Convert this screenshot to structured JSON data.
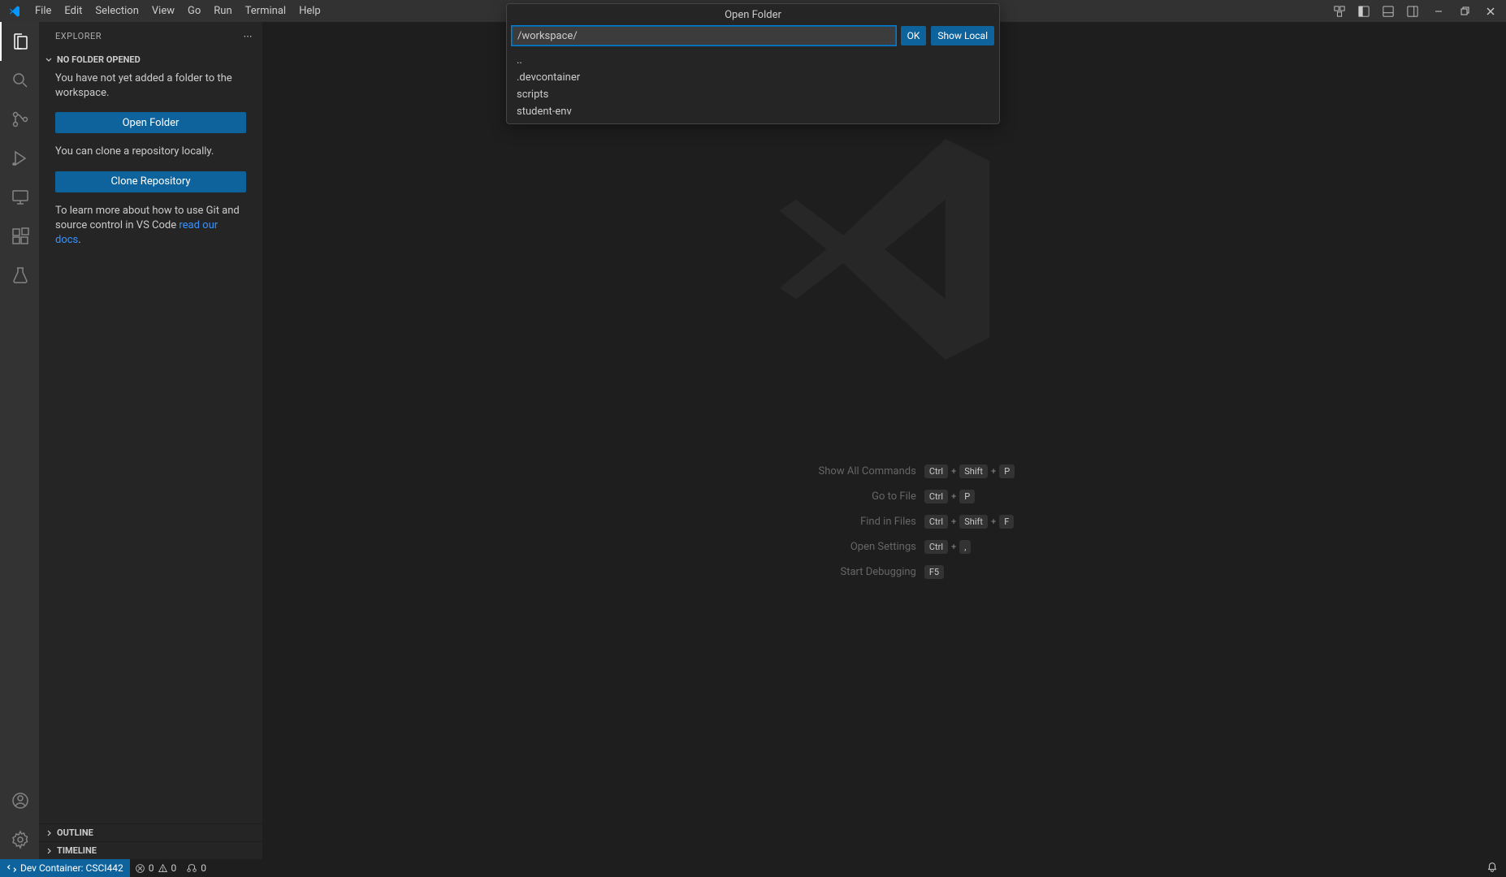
{
  "menubar": {
    "items": [
      "File",
      "Edit",
      "Selection",
      "View",
      "Go",
      "Run",
      "Terminal",
      "Help"
    ]
  },
  "sidebar": {
    "title": "EXPLORER",
    "section": "NO FOLDER OPENED",
    "msg1": "You have not yet added a folder to the workspace.",
    "openFolder": "Open Folder",
    "msg2": "You can clone a repository locally.",
    "cloneRepo": "Clone Repository",
    "msg3a": "To learn more about how to use Git and source control in VS Code ",
    "msg3link": "read our docs",
    "msg3b": ".",
    "outline": "OUTLINE",
    "timeline": "TIMELINE"
  },
  "shortcuts": {
    "rows": [
      {
        "label": "Show All Commands",
        "keys": [
          "Ctrl",
          "Shift",
          "P"
        ]
      },
      {
        "label": "Go to File",
        "keys": [
          "Ctrl",
          "P"
        ]
      },
      {
        "label": "Find in Files",
        "keys": [
          "Ctrl",
          "Shift",
          "F"
        ]
      },
      {
        "label": "Open Settings",
        "keys": [
          "Ctrl",
          ","
        ]
      },
      {
        "label": "Start Debugging",
        "keys": [
          "F5"
        ]
      }
    ]
  },
  "statusbar": {
    "remote": "Dev Container: CSCI442",
    "errors": "0",
    "warnings": "0",
    "ports": "0"
  },
  "quickinput": {
    "title": "Open Folder",
    "value": "/workspace/",
    "ok": "OK",
    "showlocal": "Show Local",
    "items": [
      "..",
      ".devcontainer",
      "scripts",
      "student-env"
    ]
  }
}
